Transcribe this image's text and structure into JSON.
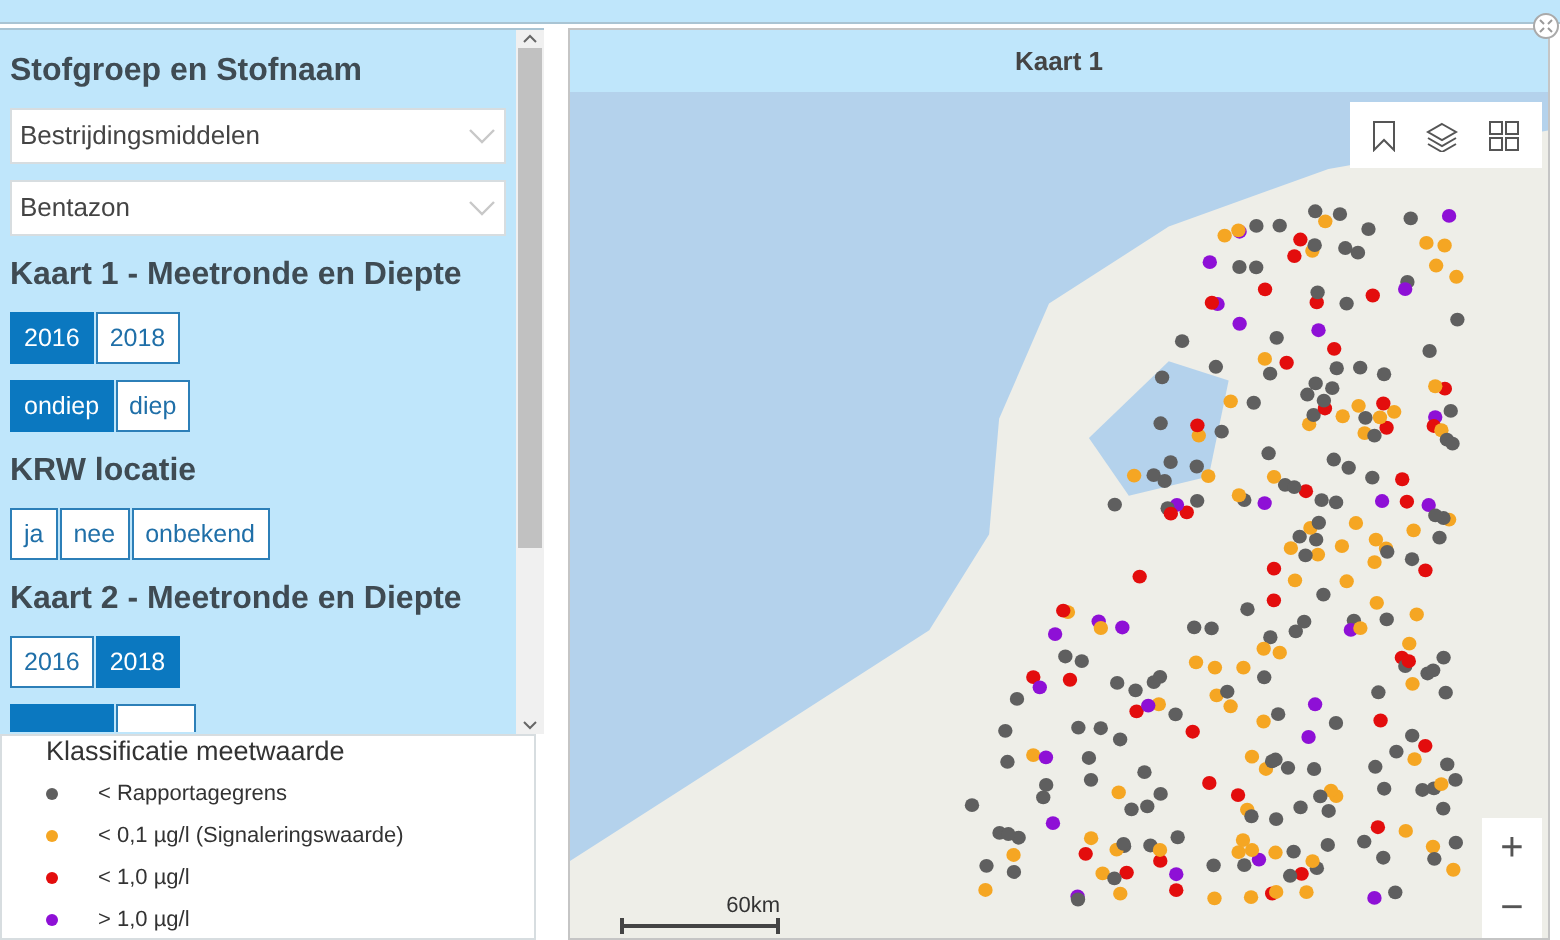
{
  "sidebar": {
    "sections": [
      {
        "kind": "heading",
        "text": "Stofgroep en Stofnaam"
      },
      {
        "kind": "select",
        "value": "Bestrijdingsmiddelen"
      },
      {
        "kind": "select",
        "value": "Bentazon"
      },
      {
        "kind": "heading",
        "text": "Kaart 1 - Meetronde en Diepte"
      },
      {
        "kind": "toggles",
        "buttons": [
          {
            "label": "2016",
            "selected": true
          },
          {
            "label": "2018",
            "selected": false
          }
        ]
      },
      {
        "kind": "toggles",
        "buttons": [
          {
            "label": "ondiep",
            "selected": true
          },
          {
            "label": "diep",
            "selected": false
          }
        ]
      },
      {
        "kind": "heading",
        "text": "KRW locatie"
      },
      {
        "kind": "toggles",
        "buttons": [
          {
            "label": "ja",
            "selected": false
          },
          {
            "label": "nee",
            "selected": false
          },
          {
            "label": "onbekend",
            "selected": false
          }
        ]
      },
      {
        "kind": "heading",
        "text": "Kaart 2 - Meetronde en Diepte"
      },
      {
        "kind": "toggles",
        "buttons": [
          {
            "label": "2016",
            "selected": false
          },
          {
            "label": "2018",
            "selected": true
          }
        ]
      },
      {
        "kind": "cut_toggles",
        "buttons": [
          {
            "selected": true
          },
          {
            "selected": false
          }
        ]
      }
    ]
  },
  "legend": {
    "title": "Klassificatie meetwaarde",
    "items": [
      {
        "label": "< Rapportagegrens",
        "color": "#5f5f5f"
      },
      {
        "label": "< 0,1 µg/l (Signaleringswaarde)",
        "color": "#f5a623"
      },
      {
        "label": "< 1,0 µg/l",
        "color": "#e30d0d"
      },
      {
        "label": "> 1,0 µg/l",
        "color": "#8e10d6"
      }
    ]
  },
  "map": {
    "title": "Kaart 1",
    "scale_label": "60km",
    "zoom_in": "+",
    "zoom_out": "−"
  }
}
